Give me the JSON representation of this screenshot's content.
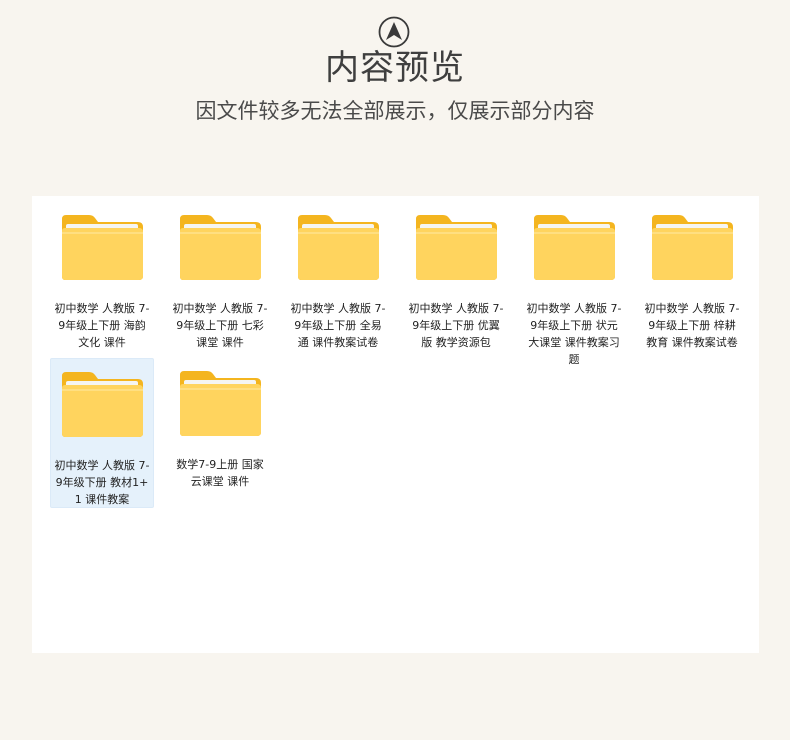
{
  "header": {
    "title": "内容预览",
    "subtitle": "因文件较多无法全部展示，仅展示部分内容"
  },
  "folders": [
    {
      "label": "初中数学 人教版 7-9年级上下册 海韵文化 课件",
      "selected": false
    },
    {
      "label": "初中数学 人教版 7-9年级上下册 七彩课堂 课件",
      "selected": false
    },
    {
      "label": "初中数学 人教版 7-9年级上下册 全易通 课件教案试卷",
      "selected": false
    },
    {
      "label": "初中数学 人教版 7-9年级上下册 优翼版 教学资源包",
      "selected": false
    },
    {
      "label": "初中数学 人教版 7-9年级上下册 状元大课堂 课件教案习题",
      "selected": false
    },
    {
      "label": "初中数学 人教版 7-9年级上下册 梓耕教育 课件教案试卷",
      "selected": false
    },
    {
      "label": "初中数学 人教版 7-9年级下册 教材1+1 课件教案",
      "selected": true
    },
    {
      "label": "数学7-9上册 国家云课堂 课件",
      "selected": false
    }
  ],
  "colors": {
    "background": "#f8f5ef",
    "panel": "#ffffff",
    "folder_back": "#f4b51f",
    "folder_front": "#ffd45e",
    "selected_bg": "#e5f1fb"
  },
  "icons": {
    "top": "navigation-arrow-icon",
    "folder": "folder-icon"
  }
}
